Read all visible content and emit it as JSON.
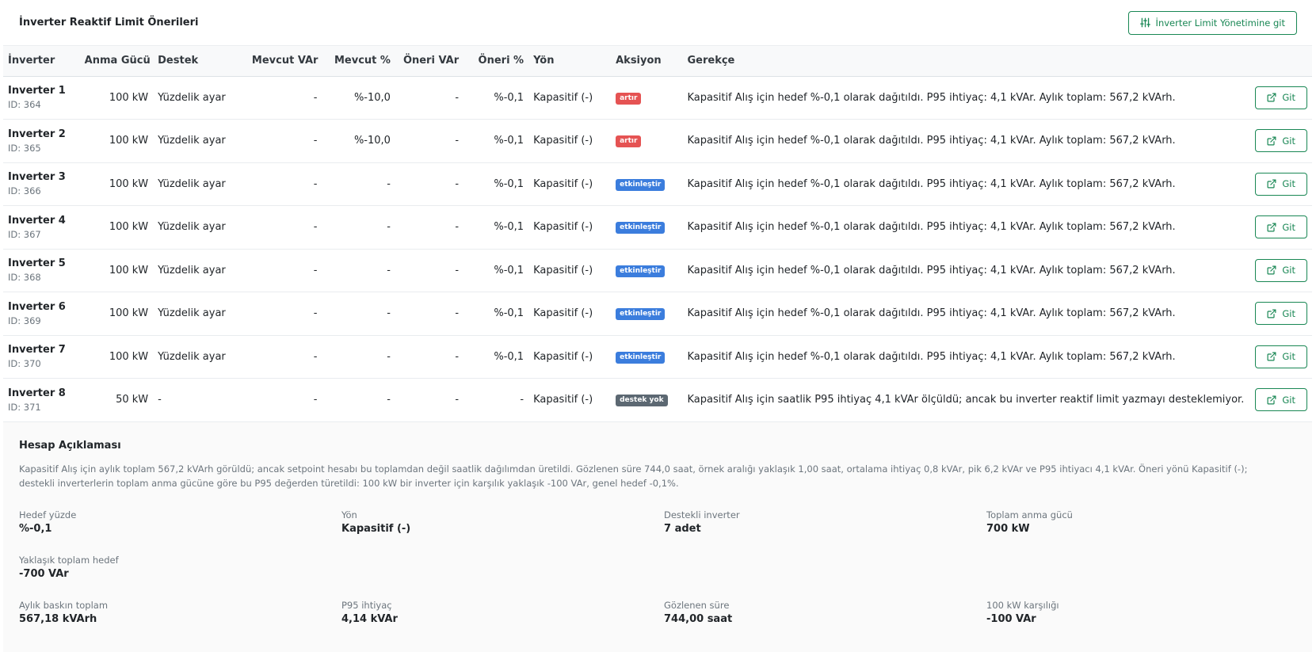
{
  "header": {
    "title": "İnverter Reaktif Limit Önerileri",
    "button_label": "İnverter Limit Yönetimine git",
    "button_icon": "sliders-icon"
  },
  "colors": {
    "accent": "#198754",
    "badge_artir": "#e55353",
    "badge_etkinlestir": "#3b7ddd",
    "badge_destek_yok": "#5c6872"
  },
  "table": {
    "columns": [
      "İnverter",
      "Anma Gücü",
      "Destek",
      "Mevcut VAr",
      "Mevcut %",
      "Öneri VAr",
      "Öneri %",
      "Yön",
      "Aksiyon",
      "Gerekçe"
    ],
    "go_label": "Git",
    "go_icon": "external-link-icon",
    "rows": [
      {
        "name": "Inverter 1",
        "id": "ID: 364",
        "power": "100 kW",
        "support": "Yüzdelik ayar",
        "cur_var": "-",
        "cur_pct": "%-10,0",
        "rec_var": "-",
        "rec_pct": "%-0,1",
        "dir": "Kapasitif (-)",
        "action": "artır",
        "action_type": "artir",
        "reason": "Kapasitif Alış için hedef %-0,1 olarak dağıtıldı. P95 ihtiyaç: 4,1 kVAr. Aylık toplam: 567,2 kVArh."
      },
      {
        "name": "Inverter 2",
        "id": "ID: 365",
        "power": "100 kW",
        "support": "Yüzdelik ayar",
        "cur_var": "-",
        "cur_pct": "%-10,0",
        "rec_var": "-",
        "rec_pct": "%-0,1",
        "dir": "Kapasitif (-)",
        "action": "artır",
        "action_type": "artir",
        "reason": "Kapasitif Alış için hedef %-0,1 olarak dağıtıldı. P95 ihtiyaç: 4,1 kVAr. Aylık toplam: 567,2 kVArh."
      },
      {
        "name": "Inverter 3",
        "id": "ID: 366",
        "power": "100 kW",
        "support": "Yüzdelik ayar",
        "cur_var": "-",
        "cur_pct": "-",
        "rec_var": "-",
        "rec_pct": "%-0,1",
        "dir": "Kapasitif (-)",
        "action": "etkinleştir",
        "action_type": "etkinlestir",
        "reason": "Kapasitif Alış için hedef %-0,1 olarak dağıtıldı. P95 ihtiyaç: 4,1 kVAr. Aylık toplam: 567,2 kVArh."
      },
      {
        "name": "Inverter 4",
        "id": "ID: 367",
        "power": "100 kW",
        "support": "Yüzdelik ayar",
        "cur_var": "-",
        "cur_pct": "-",
        "rec_var": "-",
        "rec_pct": "%-0,1",
        "dir": "Kapasitif (-)",
        "action": "etkinleştir",
        "action_type": "etkinlestir",
        "reason": "Kapasitif Alış için hedef %-0,1 olarak dağıtıldı. P95 ihtiyaç: 4,1 kVAr. Aylık toplam: 567,2 kVArh."
      },
      {
        "name": "Inverter 5",
        "id": "ID: 368",
        "power": "100 kW",
        "support": "Yüzdelik ayar",
        "cur_var": "-",
        "cur_pct": "-",
        "rec_var": "-",
        "rec_pct": "%-0,1",
        "dir": "Kapasitif (-)",
        "action": "etkinleştir",
        "action_type": "etkinlestir",
        "reason": "Kapasitif Alış için hedef %-0,1 olarak dağıtıldı. P95 ihtiyaç: 4,1 kVAr. Aylık toplam: 567,2 kVArh."
      },
      {
        "name": "Inverter 6",
        "id": "ID: 369",
        "power": "100 kW",
        "support": "Yüzdelik ayar",
        "cur_var": "-",
        "cur_pct": "-",
        "rec_var": "-",
        "rec_pct": "%-0,1",
        "dir": "Kapasitif (-)",
        "action": "etkinleştir",
        "action_type": "etkinlestir",
        "reason": "Kapasitif Alış için hedef %-0,1 olarak dağıtıldı. P95 ihtiyaç: 4,1 kVAr. Aylık toplam: 567,2 kVArh."
      },
      {
        "name": "Inverter 7",
        "id": "ID: 370",
        "power": "100 kW",
        "support": "Yüzdelik ayar",
        "cur_var": "-",
        "cur_pct": "-",
        "rec_var": "-",
        "rec_pct": "%-0,1",
        "dir": "Kapasitif (-)",
        "action": "etkinleştir",
        "action_type": "etkinlestir",
        "reason": "Kapasitif Alış için hedef %-0,1 olarak dağıtıldı. P95 ihtiyaç: 4,1 kVAr. Aylık toplam: 567,2 kVArh."
      },
      {
        "name": "Inverter 8",
        "id": "ID: 371",
        "power": "50 kW",
        "support": "-",
        "cur_var": "-",
        "cur_pct": "-",
        "rec_var": "-",
        "rec_pct": "-",
        "dir": "Kapasitif (-)",
        "action": "destek yok",
        "action_type": "destek_yok",
        "reason": "Kapasitif Alış için saatlik P95 ihtiyaç 4,1 kVAr ölçüldü; ancak bu inverter reaktif limit yazmayı desteklemiyor."
      }
    ]
  },
  "explanation": {
    "title": "Hesap Açıklaması",
    "text": "Kapasitif Alış için aylık toplam 567,2 kVArh görüldü; ancak setpoint hesabı bu toplamdan değil saatlik dağılımdan üretildi. Gözlenen süre 744,0 saat, örnek aralığı yaklaşık 1,00 saat, ortalama ihtiyaç 0,8 kVAr, pik 6,2 kVAr ve P95 ihtiyacı 4,1 kVAr. Öneri yönü Kapasitif (-); destekli inverterlerin toplam anma gücüne göre bu P95 değerden türetildi: 100 kW bir inverter için karşılık yaklaşık -100 VAr, genel hedef -0,1%.",
    "stats": [
      {
        "label": "Hedef yüzde",
        "value": "%-0,1"
      },
      {
        "label": "Yön",
        "value": "Kapasitif (-)"
      },
      {
        "label": "Destekli inverter",
        "value": "7 adet"
      },
      {
        "label": "Toplam anma gücü",
        "value": "700 kW"
      },
      {
        "label": "Yaklaşık toplam hedef",
        "value": "-700 VAr"
      },
      {
        "label": "",
        "value": ""
      },
      {
        "label": "",
        "value": ""
      },
      {
        "label": "",
        "value": ""
      },
      {
        "label": "Aylık baskın toplam",
        "value": "567,18 kVArh"
      },
      {
        "label": "P95 ihtiyaç",
        "value": "4,14 kVAr"
      },
      {
        "label": "Gözlenen süre",
        "value": "744,00 saat"
      },
      {
        "label": "100 kW karşılığı",
        "value": "-100 VAr"
      }
    ]
  }
}
